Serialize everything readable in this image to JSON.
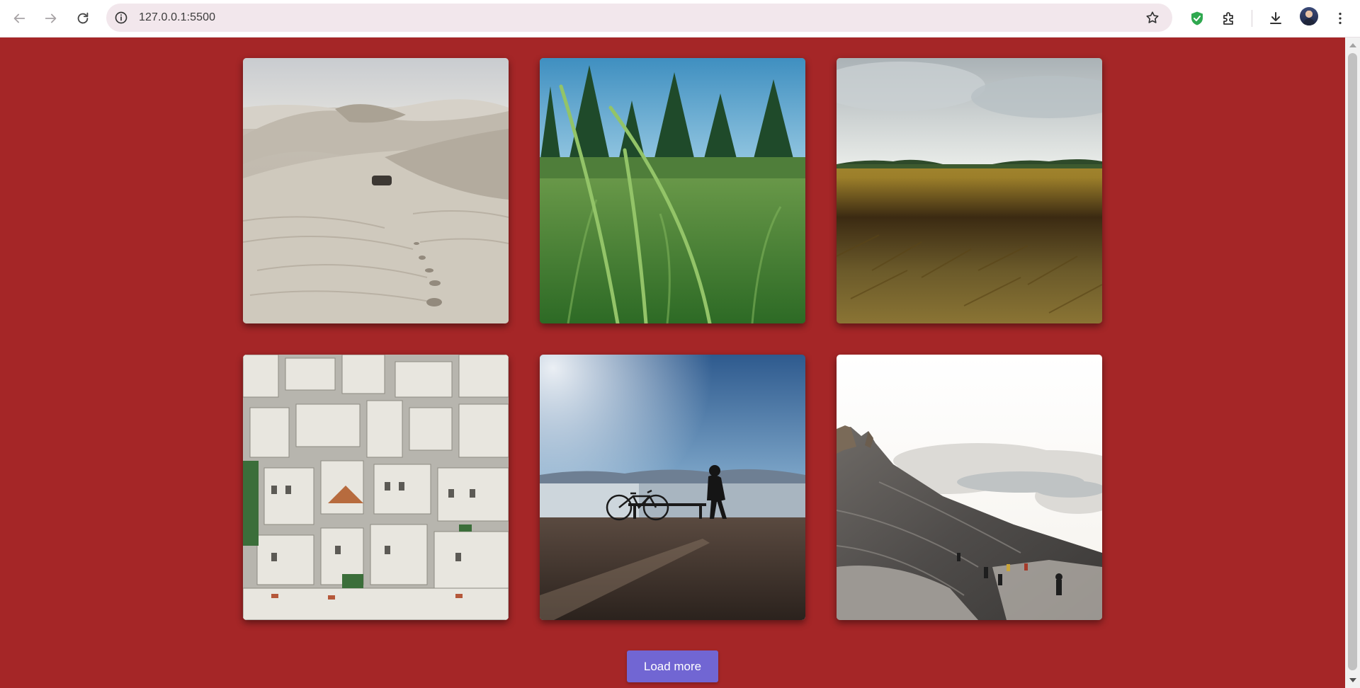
{
  "browser": {
    "url": "127.0.0.1:5500",
    "icons": [
      "back-arrow-icon",
      "forward-arrow-icon",
      "reload-icon",
      "site-info-icon",
      "bookmark-star-icon",
      "shield-extension-icon",
      "extensions-puzzle-icon",
      "download-icon",
      "profile-avatar",
      "more-menu-icon"
    ]
  },
  "gallery": {
    "photos": [
      {
        "subject": "desert-dunes"
      },
      {
        "subject": "grass-closeup"
      },
      {
        "subject": "wheat-field"
      },
      {
        "subject": "city-rooftops"
      },
      {
        "subject": "bicycle-by-bay"
      },
      {
        "subject": "mountain-above-clouds"
      }
    ]
  },
  "load_more": {
    "label": "Load more"
  },
  "colors": {
    "page_background": "#a52627",
    "button_background": "#7166d3",
    "omnibox_background": "#f2e7ec"
  }
}
